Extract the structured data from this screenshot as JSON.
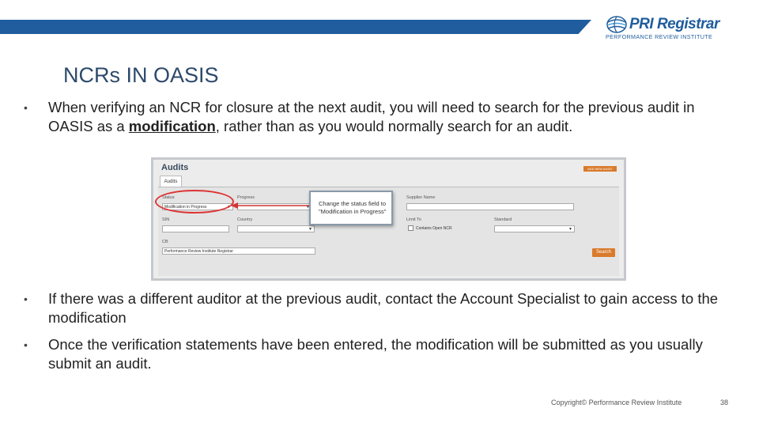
{
  "header": {
    "logo_name": "PRI Registrar",
    "logo_sub": "PERFORMANCE REVIEW INSTITUTE",
    "brand_color": "#1f5d9e"
  },
  "slide": {
    "title": "NCRs IN OASIS",
    "bullet_glyph": "•",
    "bullet1_a": "When verifying an NCR for closure at the next audit, you will need to search for the previous audit in OASIS as a ",
    "bullet1_mod": "modification",
    "bullet1_b": ", rather than as you would normally search for an audit.",
    "bullet2": "If there was a different auditor at the previous audit, contact the Account Specialist to gain access to the modification",
    "bullet3": "Once the verification statements have been entered, the modification will be submitted as you usually submit an audit."
  },
  "screenshot": {
    "title": "Audits",
    "add_button": "ADD NEW AUDIT",
    "tab": "Audits",
    "status_label": "Status",
    "status_value": "Modification in Progress",
    "progress_label": "Progress",
    "supplier_label": "Supplier Name",
    "sin_label": "SIN",
    "country_label": "Country",
    "limit_label": "Limit To",
    "limit_value": "Contains Open NCR",
    "standard_label": "Standard",
    "cb_label": "CB",
    "cb_value": "Performance Review Institute Registrar",
    "search_button": "Search",
    "callout_line1": "Change the status field to",
    "callout_line2": "\"Modification in Progress\"",
    "callout_color": "#d33333",
    "accent_button": "#d97a2b"
  },
  "footer": {
    "copyright": "Copyright© Performance Review Institute",
    "page": "38"
  }
}
